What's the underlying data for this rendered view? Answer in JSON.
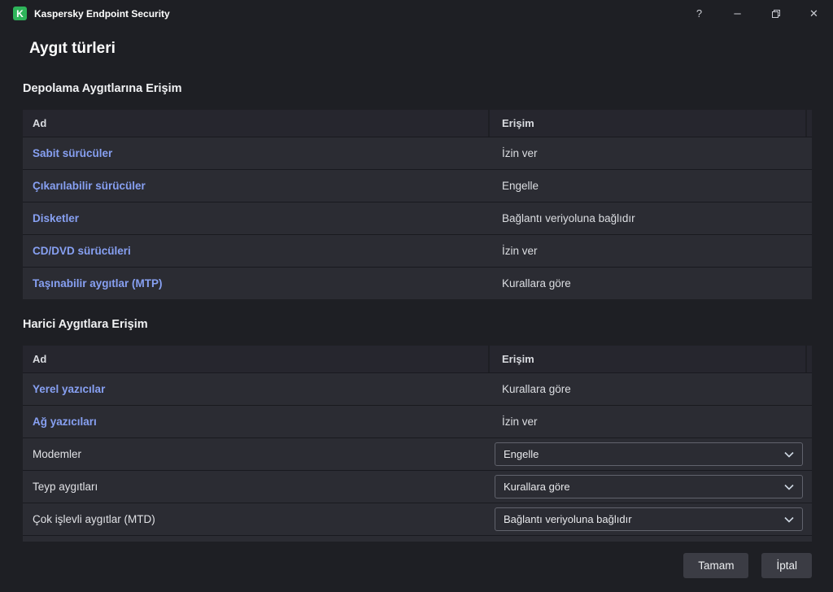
{
  "window": {
    "title": "Kaspersky Endpoint Security",
    "logo_letter": "K",
    "brand_color": "#2eb45a",
    "controls": {
      "help": "?",
      "minimize": "–",
      "close": "✕"
    }
  },
  "page": {
    "title": "Aygıt türleri"
  },
  "sections": [
    {
      "heading": "Depolama Aygıtlarına Erişim",
      "columns": [
        "Ad",
        "Erişim"
      ],
      "rows": [
        {
          "name": "Sabit sürücüler",
          "access": "İzin ver",
          "link": true,
          "control": "text"
        },
        {
          "name": "Çıkarılabilir sürücüler",
          "access": "Engelle",
          "link": true,
          "control": "text"
        },
        {
          "name": "Disketler",
          "access": "Bağlantı veriyoluna bağlıdır",
          "link": true,
          "control": "text"
        },
        {
          "name": "CD/DVD sürücüleri",
          "access": "İzin ver",
          "link": true,
          "control": "text"
        },
        {
          "name": "Taşınabilir aygıtlar (MTP)",
          "access": "Kurallara göre",
          "link": true,
          "control": "text"
        }
      ]
    },
    {
      "heading": "Harici Aygıtlara Erişim",
      "columns": [
        "Ad",
        "Erişim"
      ],
      "rows": [
        {
          "name": "Yerel yazıcılar",
          "access": "Kurallara göre",
          "link": true,
          "control": "text"
        },
        {
          "name": "Ağ yazıcıları",
          "access": "İzin ver",
          "link": true,
          "control": "text"
        },
        {
          "name": "Modemler",
          "access": "Engelle",
          "link": false,
          "control": "select"
        },
        {
          "name": "Teyp aygıtları",
          "access": "Kurallara göre",
          "link": false,
          "control": "select"
        },
        {
          "name": "Çok işlevli aygıtlar (MTD)",
          "access": "Bağlantı veriyoluna bağlıdır",
          "link": false,
          "control": "select"
        }
      ]
    }
  ],
  "footer": {
    "ok": "Tamam",
    "cancel": "İptal"
  },
  "colors": {
    "link": "#87a0f2"
  }
}
